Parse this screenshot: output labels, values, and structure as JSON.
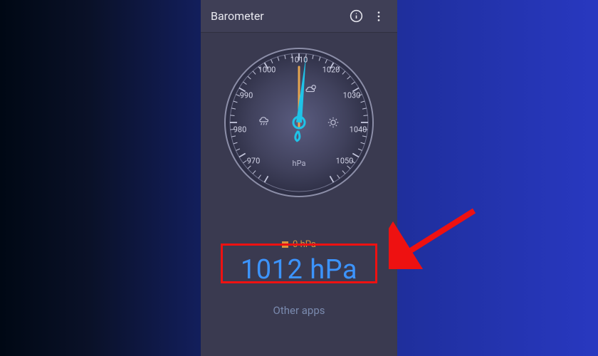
{
  "app": {
    "title": "Barometer",
    "info_icon": "info",
    "menu_icon": "more-vert"
  },
  "gauge": {
    "unit": "hPa",
    "min": 960,
    "max": 1060,
    "value": 1012,
    "ticks": [
      970,
      980,
      990,
      1000,
      1010,
      1020,
      1030,
      1040,
      1050
    ]
  },
  "change": {
    "text": "0 hPa"
  },
  "reading": {
    "text": "1012 hPa"
  },
  "links": {
    "other_apps": "Other apps"
  },
  "annotations": {
    "highlight": "pressure reading",
    "arrow": "points to reading"
  }
}
